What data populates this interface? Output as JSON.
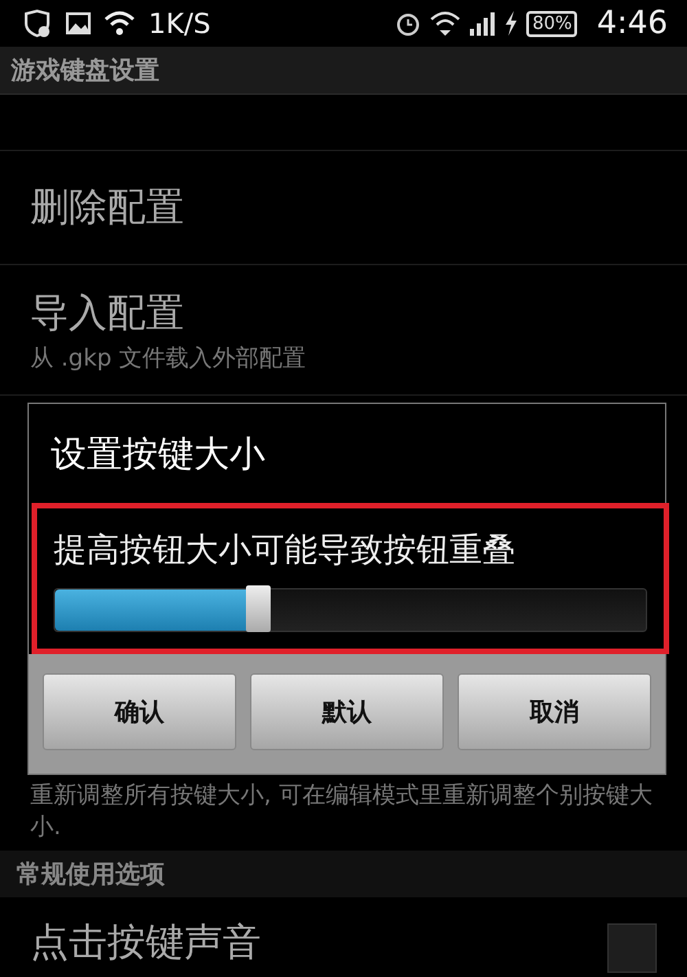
{
  "status_bar": {
    "speed": "1K/S",
    "battery": "80%",
    "time": "4:46"
  },
  "header": {
    "title": "游戏键盘设置"
  },
  "items": [
    {
      "title": "删除配置"
    },
    {
      "title": "导入配置",
      "summary": "从 .gkp 文件载入外部配置"
    }
  ],
  "partial_item": {
    "summary": "重新调整所有按键大小, 可在编辑模式里重新调整个别按键大小."
  },
  "section": {
    "title": "常规使用选项",
    "items": [
      {
        "title": "点击按键声音",
        "checked": false
      }
    ]
  },
  "dialog": {
    "title": "设置按键大小",
    "message": "提高按钮大小可能导致按钮重叠",
    "highlighted": true,
    "slider": {
      "level": 0.345
    },
    "buttons": [
      {
        "label": "确认"
      },
      {
        "label": "默认"
      },
      {
        "label": "取消"
      }
    ]
  }
}
